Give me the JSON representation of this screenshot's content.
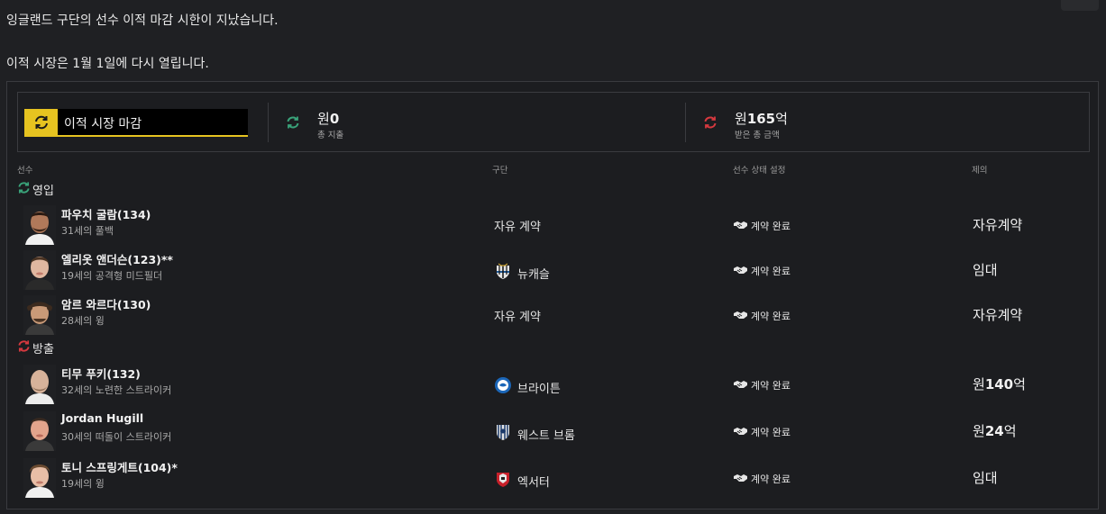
{
  "message": {
    "line1": "잉글랜드 구단의 선수 이적 마감 시한이 지났습니다.",
    "line2": "이적 시장은 1월 1일에 다시 열립니다."
  },
  "summary": {
    "deadline_label": "이적 시장 마감",
    "spend": {
      "prefix": "원",
      "amount": "0",
      "suffix": "",
      "label": "총 지출"
    },
    "received": {
      "prefix": "원",
      "amount": "165",
      "suffix": "억",
      "label": "받은 총 금액"
    }
  },
  "columns": {
    "player": "선수",
    "club": "구단",
    "status": "선수 상태 설정",
    "offer": "제의"
  },
  "sections": {
    "incoming": "영입",
    "outgoing": "방출"
  },
  "incoming": [
    {
      "name": "파우치 굴람(134)",
      "desc": "31세의 풀백",
      "club": "자유 계약",
      "club_icon": "none",
      "status": "계약 완료",
      "offer": "자유계약"
    },
    {
      "name": "엘리옷 앤더슨(123)**",
      "desc": "19세의 공격형 미드필더",
      "club": "뉴캐슬",
      "club_icon": "newcastle-badge",
      "status": "계약 완료",
      "offer": "임대"
    },
    {
      "name": "암르 와르다(130)",
      "desc": "28세의 윙",
      "club": "자유 계약",
      "club_icon": "none",
      "status": "계약 완료",
      "offer": "자유계약"
    }
  ],
  "outgoing": [
    {
      "name": "티무 푸키(132)",
      "desc": "32세의 노련한 스트라이커",
      "club": "브라이튼",
      "club_icon": "brighton-badge",
      "status": "계약 완료",
      "offer_prefix": "원",
      "offer_amount": "140",
      "offer_suffix": "억"
    },
    {
      "name": "Jordan Hugill",
      "desc": "30세의 떠돌이 스트라이커",
      "club": "웨스트 브롬",
      "club_icon": "westbrom-badge",
      "status": "계약 완료",
      "offer_prefix": "원",
      "offer_amount": "24",
      "offer_suffix": "억"
    },
    {
      "name": "토니 스프링게트(104)*",
      "desc": "19세의 윙",
      "club": "엑서터",
      "club_icon": "exeter-badge",
      "status": "계약 완료",
      "offer_text": "임대"
    }
  ],
  "colors": {
    "accent": "#e6c320",
    "incoming": "#3aa37a",
    "outgoing": "#d6393f",
    "background": "#1f2023"
  }
}
